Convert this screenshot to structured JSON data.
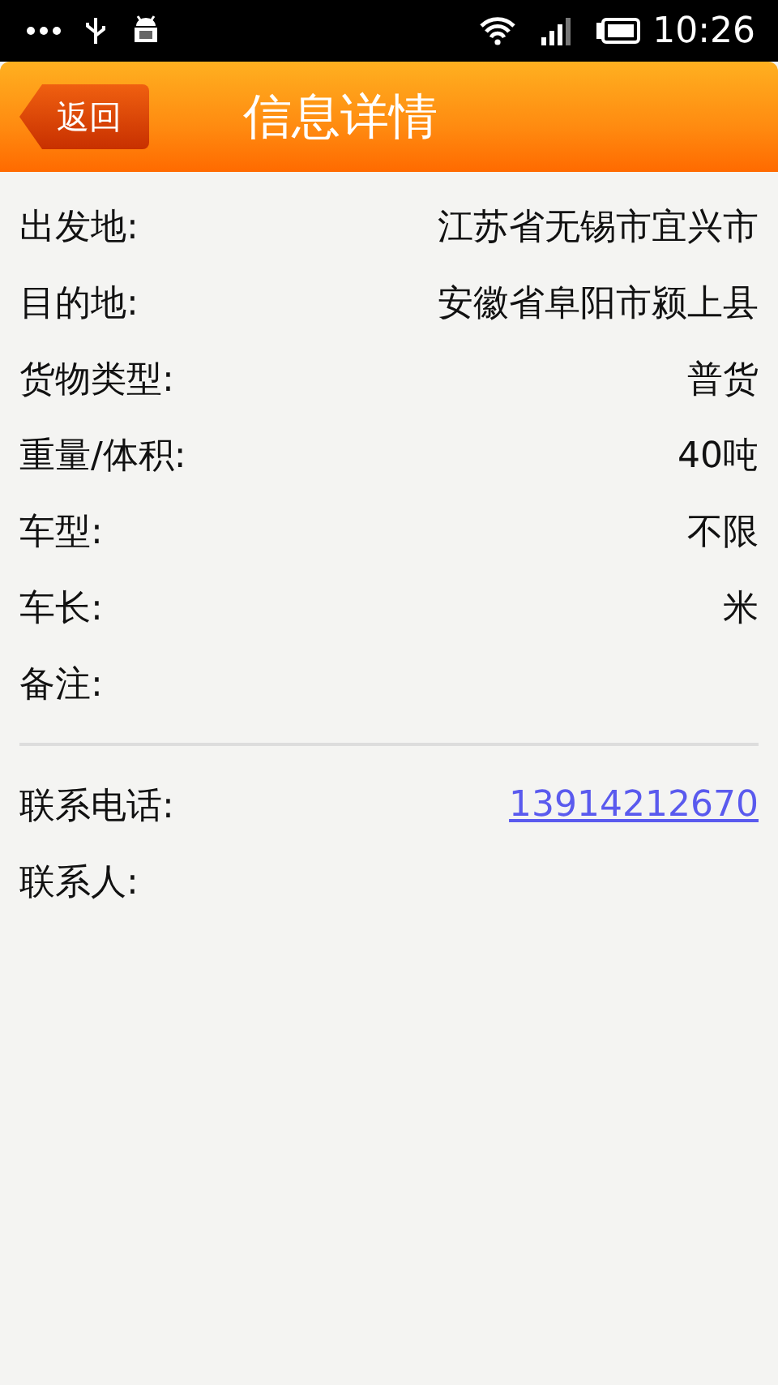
{
  "status_bar": {
    "time": "10:26"
  },
  "header": {
    "back_label": "返回",
    "title": "信息详情"
  },
  "sections": [
    {
      "rows": [
        {
          "label": "出发地:",
          "value": "江苏省无锡市宜兴市",
          "kind": "text"
        },
        {
          "label": "目的地:",
          "value": "安徽省阜阳市颍上县",
          "kind": "text"
        },
        {
          "label": "货物类型:",
          "value": "普货",
          "kind": "text"
        },
        {
          "label": "重量/体积:",
          "value": "40吨",
          "kind": "text"
        },
        {
          "label": "车型:",
          "value": "不限",
          "kind": "text"
        },
        {
          "label": "车长:",
          "value": "米",
          "kind": "text"
        },
        {
          "label": "备注:"
        }
      ]
    },
    {
      "rows": [
        {
          "label": "联系电话:",
          "value": "13914212670",
          "kind": "link"
        },
        {
          "label": "联系人:"
        }
      ]
    }
  ]
}
